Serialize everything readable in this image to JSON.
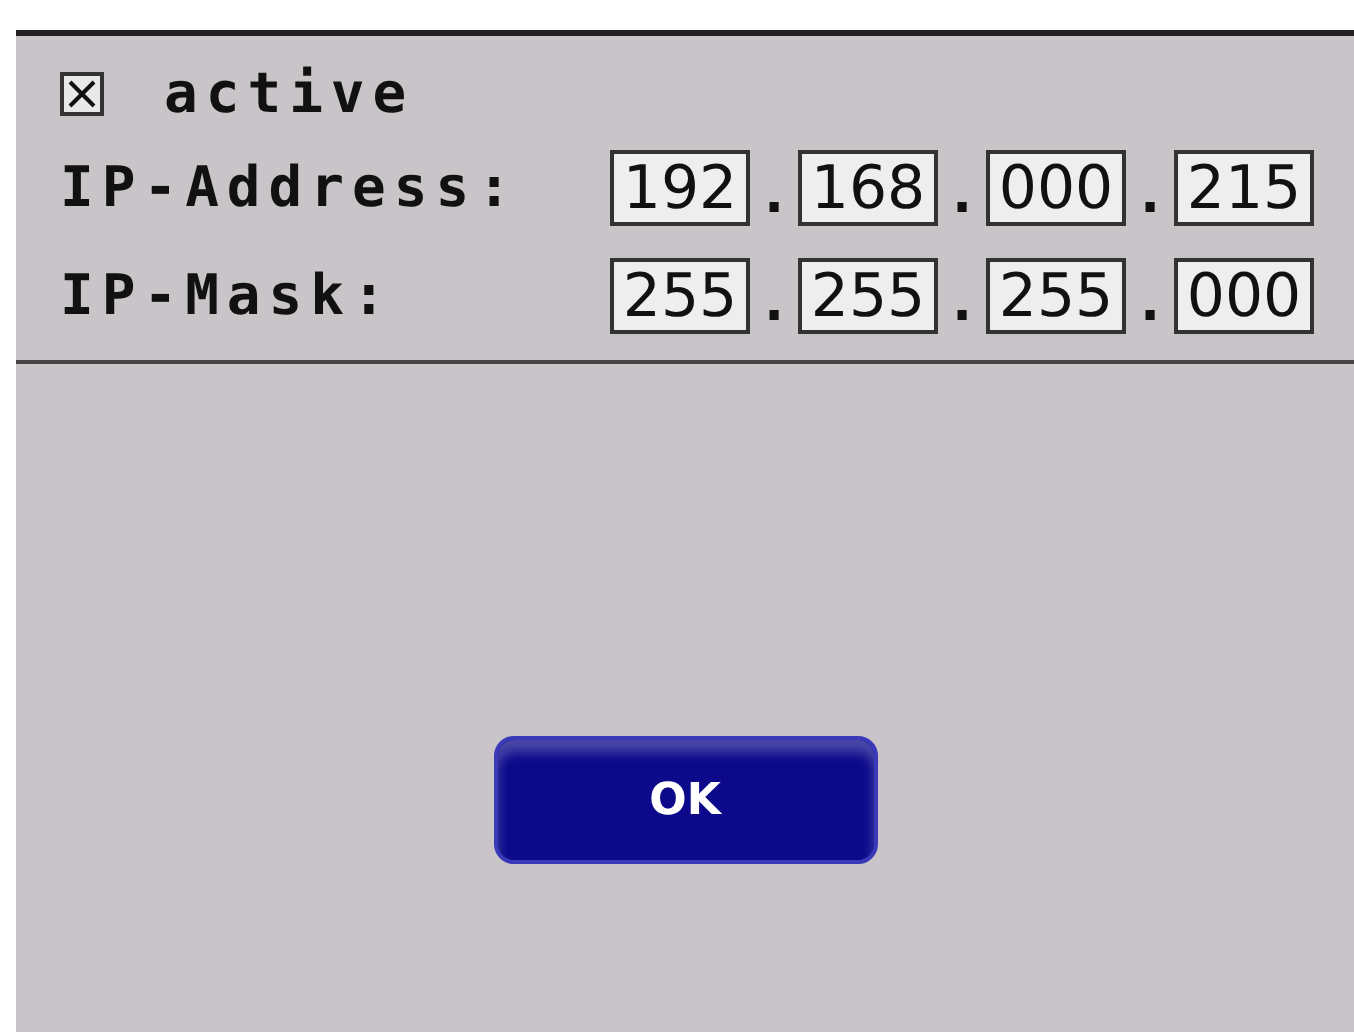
{
  "active": {
    "label": "active",
    "checked": true
  },
  "fields": [
    {
      "label": "IP-Address:",
      "octets": [
        "192",
        "168",
        "000",
        "215"
      ],
      "separator": "."
    },
    {
      "label": "IP-Mask:",
      "octets": [
        "255",
        "255",
        "255",
        "000"
      ],
      "separator": "."
    }
  ],
  "buttons": [
    {
      "label": "OK"
    }
  ]
}
